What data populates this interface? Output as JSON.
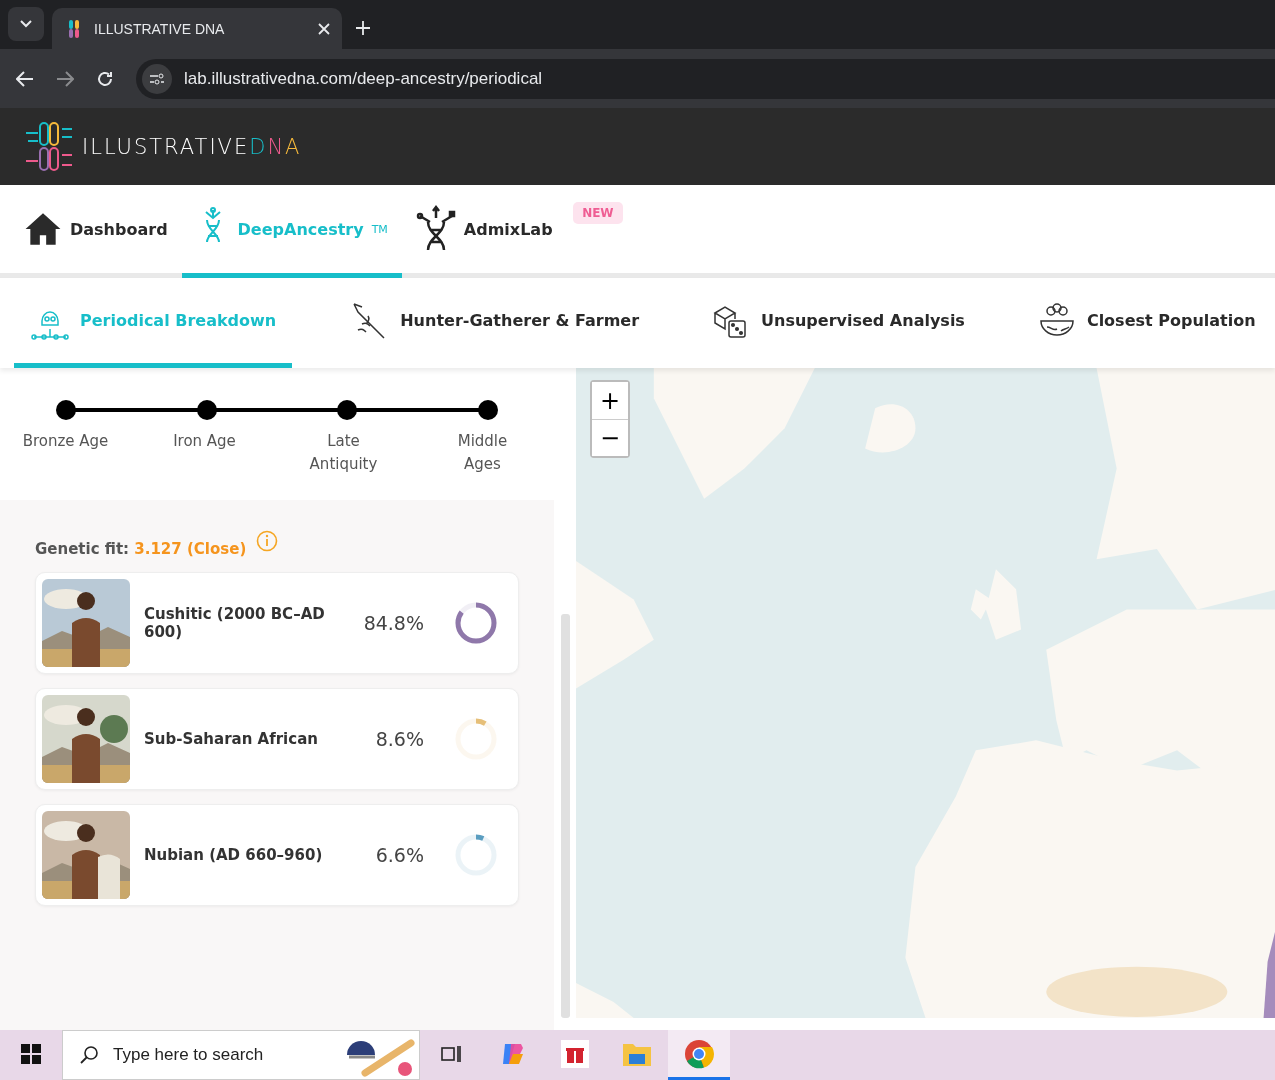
{
  "browser": {
    "tab_title": "ILLUSTRATIVE DNA",
    "url": "lab.illustrativedna.com/deep-ancestry/periodical"
  },
  "site": {
    "logo_text": "ILLUSTRATIVE",
    "logo_accent": [
      "D",
      "N",
      "A"
    ]
  },
  "main_nav": [
    {
      "label": "Dashboard",
      "selected": false
    },
    {
      "label": "DeepAncestry",
      "suffix": "TM",
      "selected": true
    },
    {
      "label": "AdmixLab",
      "selected": false,
      "badge": "NEW"
    }
  ],
  "sub_nav": [
    {
      "label": "Periodical Breakdown",
      "selected": true
    },
    {
      "label": "Hunter-Gatherer & Farmer",
      "selected": false
    },
    {
      "label": "Unsupervised Analysis",
      "selected": false
    },
    {
      "label": "Closest Population",
      "selected": false
    }
  ],
  "timeline": [
    {
      "label": "Bronze Age"
    },
    {
      "label": "Iron Age"
    },
    {
      "label": "Late Antiquity"
    },
    {
      "label": "Middle Ages"
    }
  ],
  "genetic_fit": {
    "label": "Genetic fit:",
    "value": "3.127 (Close)"
  },
  "results": [
    {
      "name": "Cushitic (2000 BC–AD 600)",
      "percent": "84.8%",
      "level": 0.848,
      "color": "#8f78aa"
    },
    {
      "name": "Sub-Saharan African",
      "percent": "8.6%",
      "level": 0.086,
      "color": "#e6bf78"
    },
    {
      "name": "Nubian (AD 660–960)",
      "percent": "6.6%",
      "level": 0.066,
      "color": "#5a9dc0"
    }
  ],
  "map": {
    "zoom_in": "+",
    "zoom_out": "−"
  },
  "taskbar": {
    "search_placeholder": "Type here to search"
  }
}
